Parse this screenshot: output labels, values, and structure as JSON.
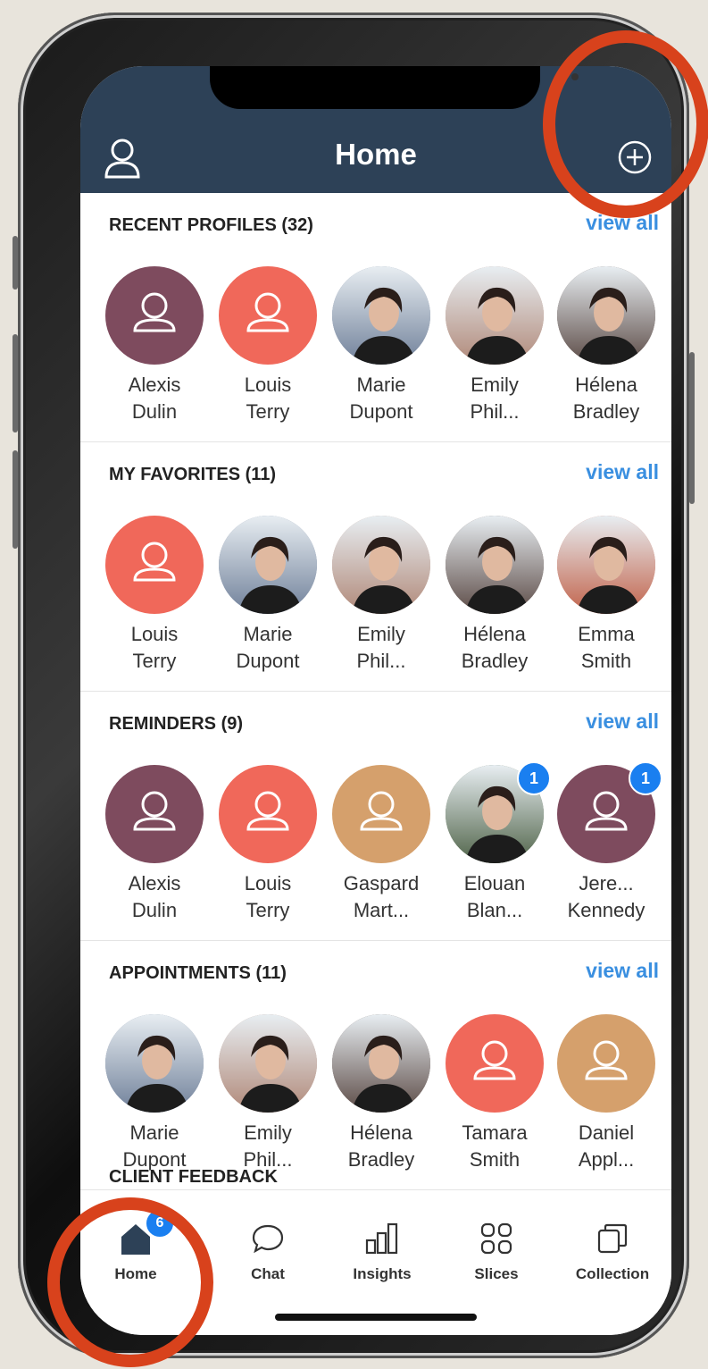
{
  "header": {
    "title": "Home",
    "user_icon": "user-icon",
    "add_icon": "plus-circle-icon"
  },
  "sections": [
    {
      "title": "RECENT PROFILES (32)",
      "view_all": "view all",
      "people": [
        {
          "first": "Alexis",
          "last": "Dulin",
          "avatar": "placeholder",
          "color": "#7e4b5e"
        },
        {
          "first": "Louis",
          "last": "Terry",
          "avatar": "placeholder",
          "color": "#f0685a"
        },
        {
          "first": "Marie",
          "last": "Dupont",
          "avatar": "photo",
          "color": "#6f7f99"
        },
        {
          "first": "Emily",
          "last": "Phil...",
          "avatar": "photo",
          "color": "#b08878"
        },
        {
          "first": "Hélena",
          "last": "Bradley",
          "avatar": "photo",
          "color": "#5b4a45"
        }
      ]
    },
    {
      "title": "MY FAVORITES (11)",
      "view_all": "view all",
      "people": [
        {
          "first": "Louis",
          "last": "Terry",
          "avatar": "placeholder",
          "color": "#f0685a"
        },
        {
          "first": "Marie",
          "last": "Dupont",
          "avatar": "photo",
          "color": "#6f7f99"
        },
        {
          "first": "Emily",
          "last": "Phil...",
          "avatar": "photo",
          "color": "#b08878"
        },
        {
          "first": "Hélena",
          "last": "Bradley",
          "avatar": "photo",
          "color": "#5b4a45"
        },
        {
          "first": "Emma",
          "last": "Smith",
          "avatar": "photo",
          "color": "#c1624a"
        }
      ]
    },
    {
      "title": "REMINDERS (9)",
      "view_all": "view all",
      "people": [
        {
          "first": "Alexis",
          "last": "Dulin",
          "avatar": "placeholder",
          "color": "#7e4b5e"
        },
        {
          "first": "Louis",
          "last": "Terry",
          "avatar": "placeholder",
          "color": "#f0685a"
        },
        {
          "first": "Gaspard",
          "last": "Mart...",
          "avatar": "placeholder",
          "color": "#d5a06c"
        },
        {
          "first": "Elouan",
          "last": "Blan...",
          "avatar": "photo",
          "color": "#4f6348",
          "badge": "1"
        },
        {
          "first": "Jere...",
          "last": "Kennedy",
          "avatar": "placeholder",
          "color": "#7e4b5e",
          "badge": "1"
        }
      ]
    },
    {
      "title": "APPOINTMENTS (11)",
      "view_all": "view all",
      "people": [
        {
          "first": "Marie",
          "last": "Dupont",
          "avatar": "photo",
          "color": "#6f7f99"
        },
        {
          "first": "Emily",
          "last": "Phil...",
          "avatar": "photo",
          "color": "#b08878"
        },
        {
          "first": "Hélena",
          "last": "Bradley",
          "avatar": "photo",
          "color": "#5b4a45"
        },
        {
          "first": "Tamara",
          "last": "Smith",
          "avatar": "placeholder",
          "color": "#f0685a"
        },
        {
          "first": "Daniel",
          "last": "Appl...",
          "avatar": "placeholder",
          "color": "#d5a06c"
        }
      ]
    }
  ],
  "partial_section_title": "CLIENT FEEDBACK",
  "tabs": [
    {
      "label": "Home",
      "icon": "home-icon",
      "badge": "6"
    },
    {
      "label": "Chat",
      "icon": "chat-icon"
    },
    {
      "label": "Insights",
      "icon": "bar-chart-icon"
    },
    {
      "label": "Slices",
      "icon": "grid-icon"
    },
    {
      "label": "Collection",
      "icon": "collection-icon"
    }
  ],
  "colors": {
    "header_bg": "#2d4157",
    "link": "#3a8fe0",
    "badge": "#1a7ff0",
    "highlight_ring": "#d8421c"
  }
}
